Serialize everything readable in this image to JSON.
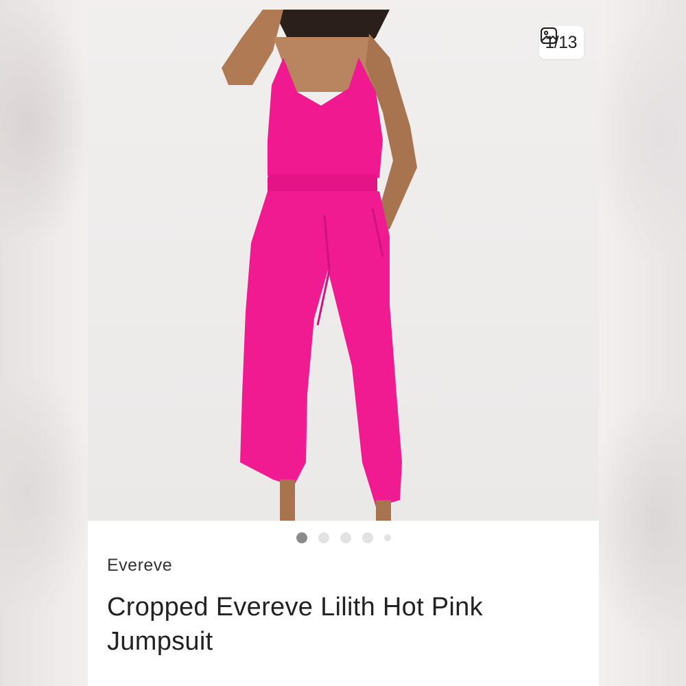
{
  "gallery": {
    "counter": "1/13",
    "total_dots": 5,
    "active_dot": 0
  },
  "listing": {
    "brand": "Evereve",
    "title": "Cropped Evereve Lilith Hot Pink Jumpsuit"
  },
  "colors": {
    "product": "#f0198f",
    "skin": "#b07a55"
  },
  "icons": {
    "counter": "image-gallery-icon"
  }
}
